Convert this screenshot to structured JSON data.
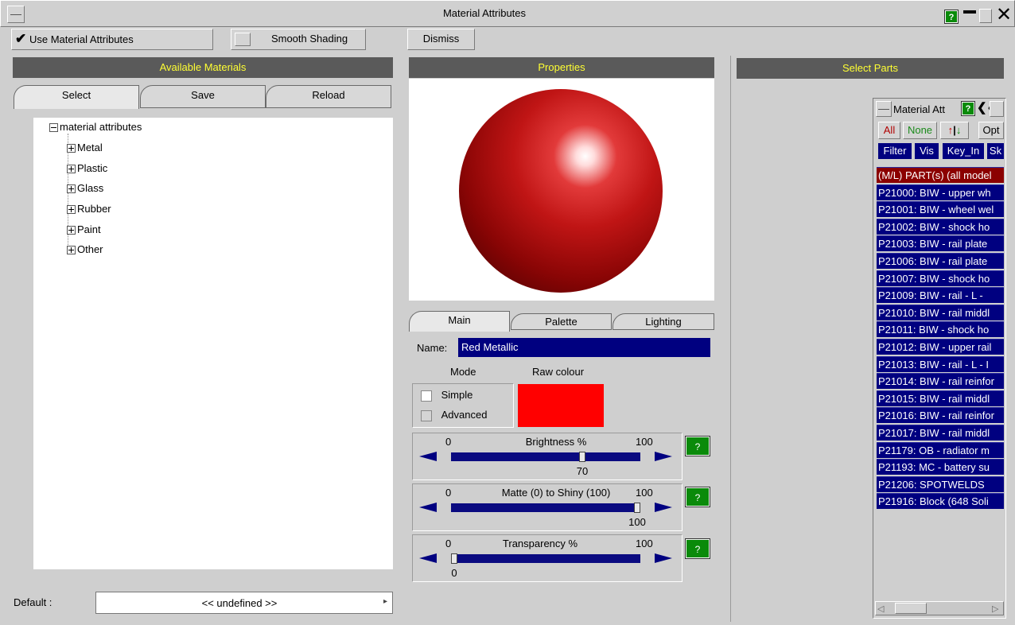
{
  "window": {
    "title": "Material Attributes",
    "help": "?"
  },
  "toolbar": {
    "use_material_attributes": "Use Material Attributes",
    "smooth_shading": "Smooth Shading",
    "dismiss": "Dismiss"
  },
  "left": {
    "header": "Available Materials",
    "tabs": [
      "Select",
      "Save",
      "Reload"
    ],
    "tree": {
      "root": "material attributes",
      "children": [
        "Metal",
        "Plastic",
        "Glass",
        "Rubber",
        "Paint",
        "Other"
      ]
    },
    "default_label": "Default :",
    "default_value": "<< undefined >>"
  },
  "middle": {
    "header": "Properties",
    "tabs": [
      "Main",
      "Palette",
      "Lighting"
    ],
    "name_label": "Name:",
    "name_value": "Red Metallic",
    "mode_label": "Mode",
    "raw_colour_label": "Raw colour",
    "raw_colour": "#ff0000",
    "mode_simple": "Simple",
    "mode_advanced": "Advanced",
    "sliders": [
      {
        "label": "Brightness %",
        "min": "0",
        "max": "100",
        "value": "70",
        "fraction": 0.7
      },
      {
        "label": "Matte (0) to Shiny (100)",
        "min": "0",
        "max": "100",
        "value": "100",
        "fraction": 1.0
      },
      {
        "label": "Transparency %",
        "min": "0",
        "max": "100",
        "value": "0",
        "fraction": 0.0
      }
    ],
    "help": "?"
  },
  "right": {
    "header": "Select Parts",
    "panel_title": "Material Att",
    "help": "?",
    "collapse": "❮❮",
    "buttons_row1": [
      "All",
      "None",
      "Opt"
    ],
    "buttons_row2": [
      "Filter",
      "Vis",
      "Key_In",
      "Sk"
    ],
    "parts": [
      "(M/L) PART(s) (all model",
      "P21000: BIW - upper wh",
      "P21001: BIW - wheel wel",
      "P21002: BIW - shock ho",
      "P21003: BIW - rail plate",
      "P21006: BIW - rail plate",
      "P21007: BIW - shock ho",
      "P21009: BIW - rail - L -",
      "P21010: BIW - rail middl",
      "P21011: BIW - shock ho",
      "P21012: BIW - upper rail",
      "P21013: BIW - rail - L - I",
      "P21014: BIW - rail reinfor",
      "P21015: BIW - rail middl",
      "P21016: BIW - rail reinfor",
      "P21017: BIW - rail middl",
      "P21179: OB - radiator m",
      "P21193: MC - battery su",
      "P21206: SPOTWELDS",
      "P21916: Block (648 Soli"
    ]
  }
}
